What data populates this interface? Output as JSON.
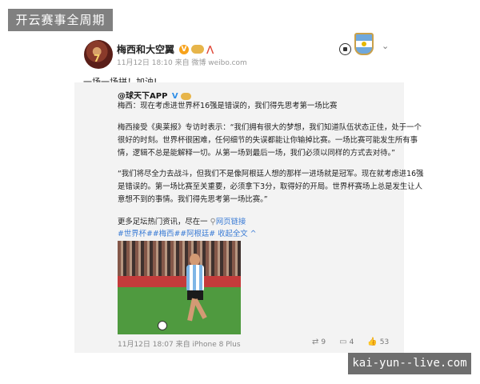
{
  "watermark": {
    "top": "开云赛事全周期",
    "bottom": "kai-yun--live.com"
  },
  "post": {
    "author": "梅西和大空翼",
    "badges": {
      "verified": "V"
    },
    "avatar_number": "7",
    "meta": "11月12日 18:10 来自 微博 weibo.com",
    "text": "一场一场拼！加油!"
  },
  "repost": {
    "source_name": "@球天下APP",
    "source_badge": "V",
    "lead": "梅西：现在考虑进世界杯16强是错误的，我们得先思考第一场比赛",
    "para1": [
      "梅西接受《奥莱报》专访时表示：“我们拥有很大的梦想，我们知道队伍状态正佳，处于一个",
      "很好的时刻。世界杯很困难，任何细节的失误都能让你输掉比赛。一场比赛可能发生所有事",
      "情，逻辑不总是能解释一切。从第一场到最后一场，我们必须以同样的方式去对待。”"
    ],
    "para2": [
      "“我们将尽全力去战斗，但我们不是像阿根廷人想的那样一进场就是冠军。现在就考虑进16强",
      "是错误的。第一场比赛至关重要，必须拿下3分，取得好的开局。世界杯赛场上总是发生让人",
      "意想不到的事情。我们得先思考第一场比赛。”"
    ],
    "more_prefix": "更多足坛热门资讯，尽在一 ",
    "more_link": "网页链接",
    "tags": "#世界杯##梅西##阿根廷# 收起全文 ^",
    "time": "11月12日 18:07 来自 iPhone 8 Plus",
    "actions": {
      "repost_count": "9",
      "comment_count": "4",
      "like_count": "53"
    }
  },
  "icons": {
    "ball": "soccer-ball-icon",
    "badge": "team-badge-icon",
    "menu": "chevron-down-icon",
    "repost": "repost-icon",
    "comment": "comment-icon",
    "like": "like-icon",
    "link": "link-icon"
  }
}
